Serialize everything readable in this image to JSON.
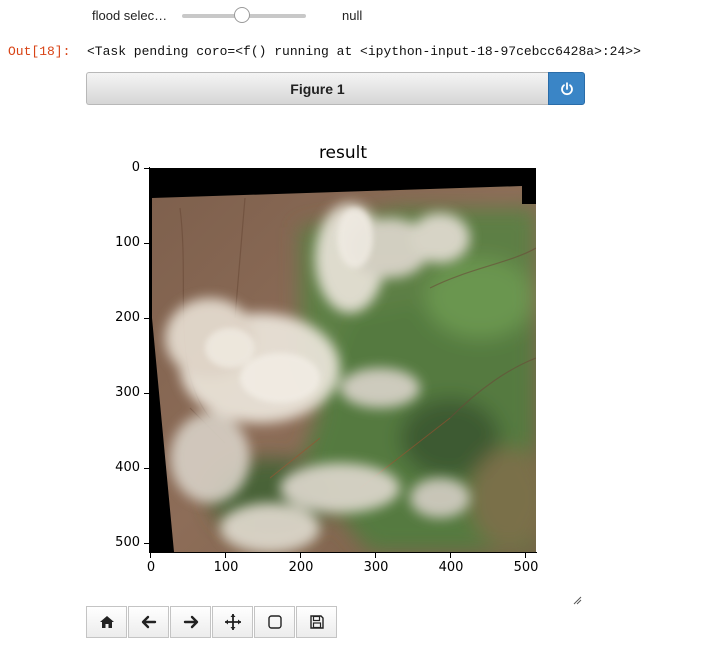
{
  "widget": {
    "label": "flood selec…",
    "value": 0.48,
    "readout": "null"
  },
  "output": {
    "prompt": "Out[18]:",
    "text": "<Task pending coro=<f() running at <ipython-input-18-97cebcc6428a>:24>>"
  },
  "figure": {
    "header_title": "Figure 1",
    "power_icon": "power-icon"
  },
  "plot": {
    "title": "result",
    "y_ticks": [
      "0",
      "100",
      "200",
      "300",
      "400",
      "500"
    ],
    "x_ticks": [
      "0",
      "100",
      "200",
      "300",
      "400",
      "500"
    ],
    "image_description_colors": {
      "soil": "#8a6a52",
      "vegetation": "#5e8a4a",
      "cloud": "#e8e2d8",
      "nodata": "#000000"
    }
  },
  "toolbar": {
    "buttons": [
      {
        "name": "home-icon"
      },
      {
        "name": "back-arrow-icon"
      },
      {
        "name": "forward-arrow-icon"
      },
      {
        "name": "pan-move-icon"
      },
      {
        "name": "zoom-rectangle-icon"
      },
      {
        "name": "save-disk-icon"
      }
    ]
  }
}
